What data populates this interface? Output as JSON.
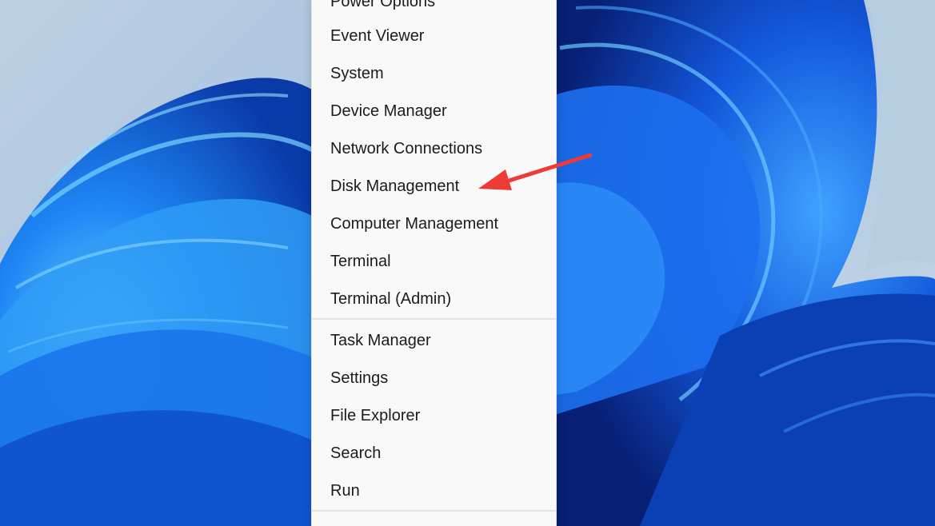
{
  "menu": {
    "group1": [
      "Power Options",
      "Event Viewer",
      "System",
      "Device Manager",
      "Network Connections",
      "Disk Management",
      "Computer Management",
      "Terminal",
      "Terminal (Admin)"
    ],
    "group2": [
      "Task Manager",
      "Settings",
      "File Explorer",
      "Search",
      "Run"
    ]
  },
  "colors": {
    "menu_background": "#f9f9f9",
    "menu_text": "#1b1b1b",
    "annotation_arrow": "#ef3b36",
    "wallpaper_blue": "#1a66e8"
  },
  "icons": {
    "annotation": "red-arrow-pointing-left"
  }
}
